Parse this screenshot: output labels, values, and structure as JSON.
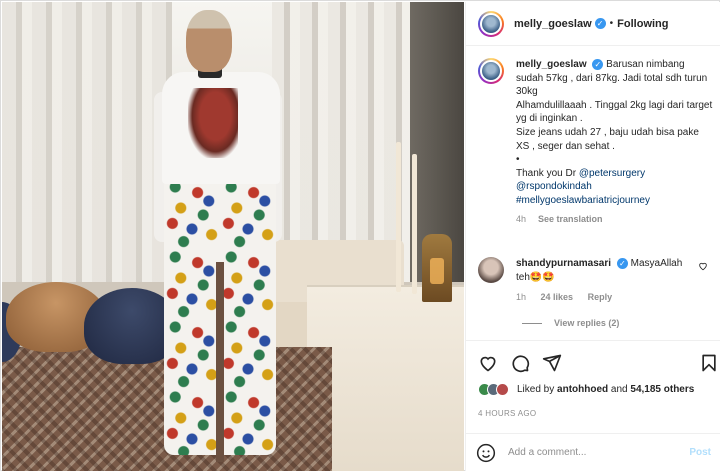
{
  "header": {
    "username": "melly_goeslaw",
    "separator": "•",
    "follow_status": "Following"
  },
  "caption": {
    "username": "melly_goeslaw",
    "lines": [
      "Barusan nimbang sudah 57kg , dari 87kg. Jadi total sdh turun 30kg",
      "Alhamdulillaaah . Tinggal 2kg lagi dari target yg di inginkan .",
      "Size jeans udah 27 , baju udah bisa pake XS , seger dan sehat .",
      "•",
      "Thank you Dr "
    ],
    "mention1": "@petersurgery",
    "mention2": "@rspondokindah",
    "hashtag": "#mellygoeslawbariatricjourney",
    "time": "4h",
    "see_translation": "See translation"
  },
  "comment": {
    "username": "shandypurnamasari",
    "text": "MasyaAllah teh🤩🤩",
    "time": "1h",
    "likes": "24 likes",
    "reply": "Reply",
    "view_replies": "View replies (2)"
  },
  "likes": {
    "prefix": "Liked by",
    "user": "antohhoed",
    "and": "and",
    "others": "54,185 others"
  },
  "timestamp": "4 HOURS AGO",
  "add_comment": {
    "placeholder": "Add a comment...",
    "post_label": "Post"
  },
  "icons": {
    "like": "heart-icon",
    "comment": "comment-icon",
    "share": "share-icon",
    "save": "bookmark-icon",
    "emoji": "emoji-icon",
    "verified": "verified-badge-icon"
  },
  "colors": {
    "verified": "#3897f0",
    "link": "#00376b",
    "meta": "#8e8e8e",
    "post_disabled": "#b2dffc"
  }
}
